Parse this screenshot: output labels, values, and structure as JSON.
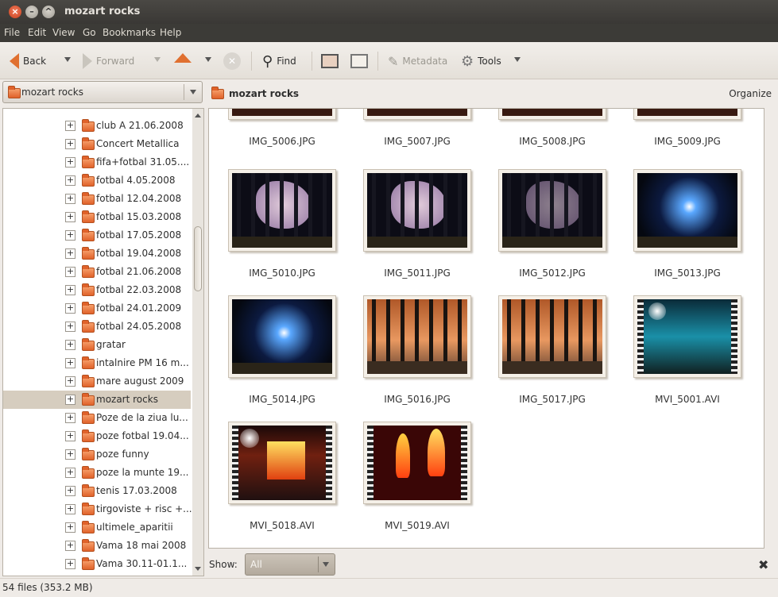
{
  "window": {
    "title": "mozart rocks"
  },
  "menu": [
    "File",
    "Edit",
    "View",
    "Go",
    "Bookmarks",
    "Help"
  ],
  "toolbar": {
    "back": "Back",
    "forward": "Forward",
    "find": "Find",
    "metadata": "Metadata",
    "tools": "Tools"
  },
  "location": {
    "current": "mozart rocks"
  },
  "folders": [
    "club A 21.06.2008",
    "Concert Metallica",
    "fifa+fotbal 31.05....",
    "fotbal 4.05.2008",
    "fotbal 12.04.2008",
    "fotbal 15.03.2008",
    "fotbal 17.05.2008",
    "fotbal 19.04.2008",
    "fotbal 21.06.2008",
    "fotbal 22.03.2008",
    "fotbal 24.01.2009",
    "fotbal 24.05.2008",
    "gratar",
    "intalnire PM 16 m...",
    "mare august 2009",
    "mozart rocks",
    "Poze de la ziua lu...",
    "poze fotbal 19.04...",
    "poze funny",
    "poze la munte 19...",
    "tenis 17.03.2008",
    "tirgoviste + risc +...",
    "ultimele_aparitii",
    "Vama 18 mai 2008",
    "Vama 30.11-01.1..."
  ],
  "selected_folder": "mozart rocks",
  "content": {
    "title": "mozart rocks",
    "organize": "Organize"
  },
  "files": [
    {
      "name": "IMG_5006.JPG",
      "kind": "concert-dark"
    },
    {
      "name": "IMG_5007.JPG",
      "kind": "concert-dark"
    },
    {
      "name": "IMG_5008.JPG",
      "kind": "concert-dark"
    },
    {
      "name": "IMG_5009.JPG",
      "kind": "concert-dark"
    },
    {
      "name": "IMG_5010.JPG",
      "kind": "flower"
    },
    {
      "name": "IMG_5011.JPG",
      "kind": "flower"
    },
    {
      "name": "IMG_5012.JPG",
      "kind": "flower-dim"
    },
    {
      "name": "IMG_5013.JPG",
      "kind": "starburst"
    },
    {
      "name": "IMG_5014.JPG",
      "kind": "starburst"
    },
    {
      "name": "IMG_5016.JPG",
      "kind": "clouds"
    },
    {
      "name": "IMG_5017.JPG",
      "kind": "clouds"
    },
    {
      "name": "MVI_5001.AVI",
      "kind": "video-blue"
    },
    {
      "name": "MVI_5018.AVI",
      "kind": "video-fire"
    },
    {
      "name": "MVI_5019.AVI",
      "kind": "video-fire2"
    }
  ],
  "filter": {
    "label": "Show:",
    "value": "All"
  },
  "status": "54 files (353.2 MB)"
}
